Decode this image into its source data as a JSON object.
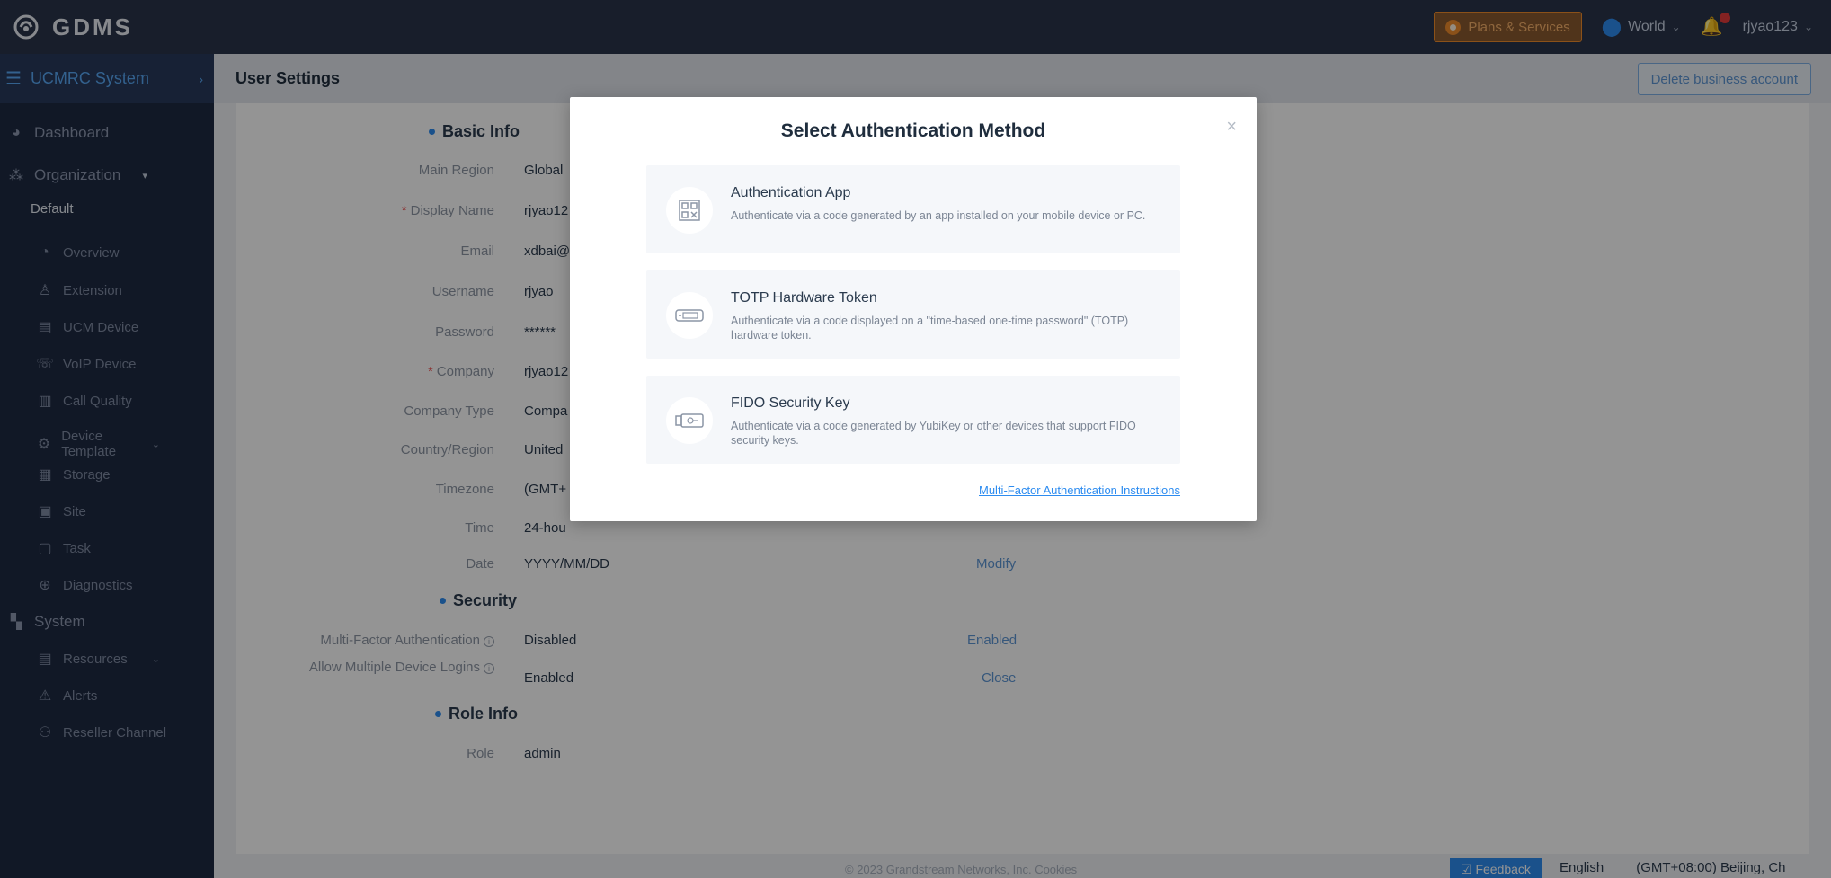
{
  "header": {
    "logo_text": "GDMS",
    "plans_label": "Plans & Services",
    "region_label": "World",
    "username": "rjyao123"
  },
  "sidebar": {
    "system_title": "UCMRC System",
    "dashboard": "Dashboard",
    "organization": "Organization",
    "default_org": "Default",
    "items": [
      "Overview",
      "Extension",
      "UCM Device",
      "VoIP Device",
      "Call Quality",
      "Device Template",
      "Storage",
      "Site",
      "Task",
      "Diagnostics"
    ],
    "system": "System",
    "system_items": [
      "Resources",
      "Alerts",
      "Reseller Channel"
    ]
  },
  "page": {
    "title": "User Settings",
    "delete_button": "Delete business account"
  },
  "basic_info": {
    "title": "Basic Info",
    "fields": [
      {
        "label": "Main Region",
        "value": "Global"
      },
      {
        "label": "Display Name",
        "value": "rjyao12"
      },
      {
        "label": "Email",
        "value": "xdbai@"
      },
      {
        "label": "Username",
        "value": "rjyao"
      },
      {
        "label": "Password",
        "value": "******"
      },
      {
        "label": "Company",
        "value": "rjyao12"
      },
      {
        "label": "Company Type",
        "value": "Compa"
      },
      {
        "label": "Country/Region",
        "value": "United"
      },
      {
        "label": "Timezone",
        "value": "(GMT+"
      },
      {
        "label": "Time",
        "value": "24-hou"
      },
      {
        "label": "Date",
        "value": "YYYY/MM/DD"
      }
    ],
    "date_action": "Modify"
  },
  "security": {
    "title": "Security",
    "mfa_label": "Multi-Factor Authentication",
    "mfa_value": "Disabled",
    "mfa_action": "Enabled",
    "multi_login_label": "Allow Multiple Device Logins",
    "multi_login_value": "Enabled",
    "multi_login_action": "Close"
  },
  "role_info": {
    "title": "Role Info",
    "role_label": "Role",
    "role_value": "admin"
  },
  "footer": {
    "copyright": "© 2023 Grandstream Networks, Inc.",
    "copyright_link": "Cookies",
    "feedback": "Feedback",
    "language": "English",
    "timezone": "(GMT+08:00) Beijing, Ch"
  },
  "modal": {
    "title": "Select Authentication Method",
    "close": "×",
    "methods": [
      {
        "name": "Authentication App",
        "description": "Authenticate via a code generated by an app installed on your mobile device or PC."
      },
      {
        "name": "TOTP Hardware Token",
        "description": "Authenticate via a code displayed on a \"time-based one-time password\" (TOTP) hardware token."
      },
      {
        "name": "FIDO Security Key",
        "description": "Authenticate via a code generated by YubiKey or other devices that support FIDO security keys."
      }
    ],
    "instructions_link": "Multi-Factor Authentication Instructions"
  },
  "colors": {
    "topbar": "#2a354b",
    "sidebar": "#1e2a42",
    "accent": "#2d8cf0",
    "plans_orange": "#f08c2c"
  }
}
